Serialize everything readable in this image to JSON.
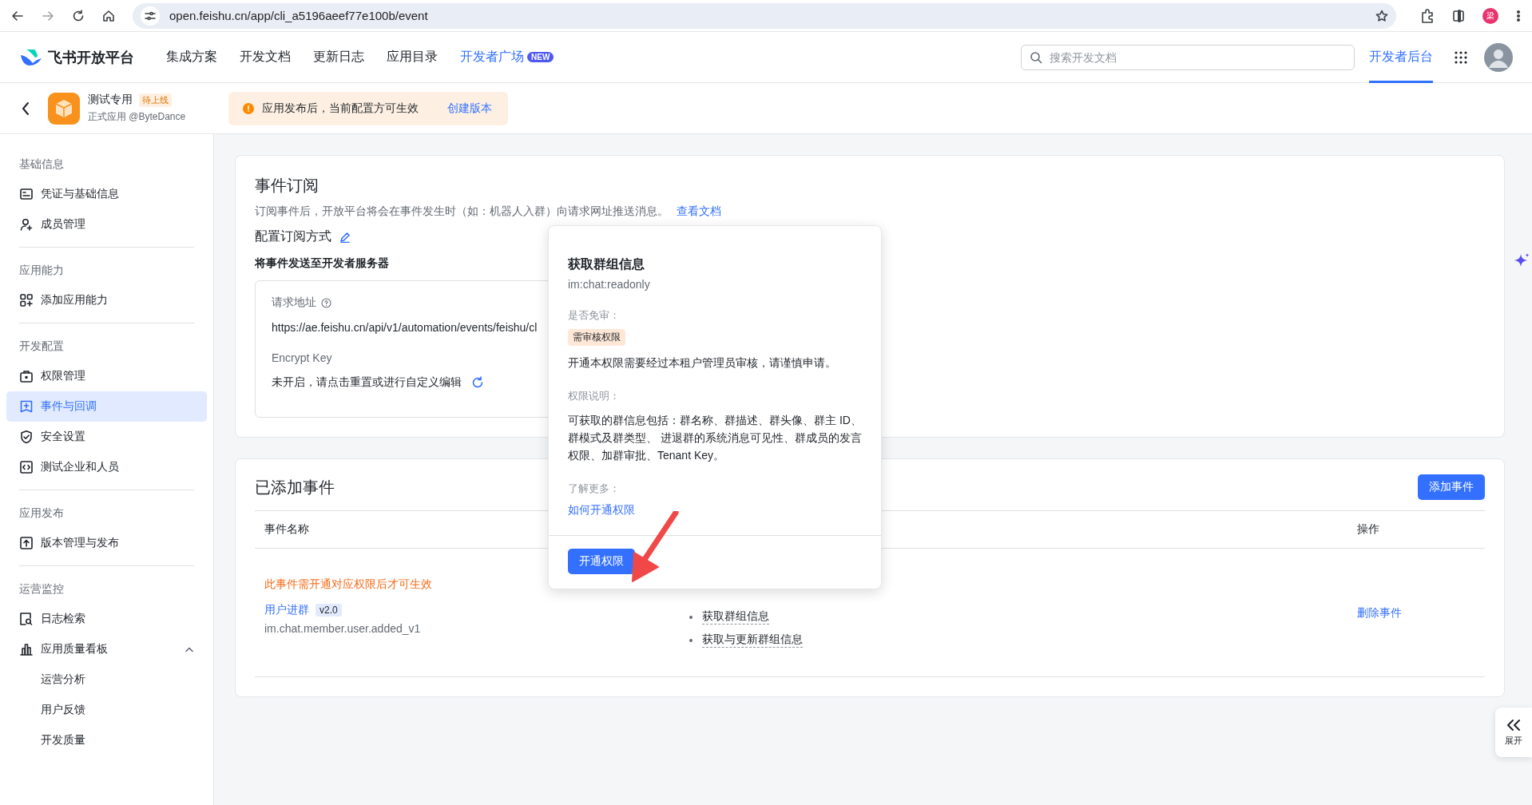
{
  "browser": {
    "url": "open.feishu.cn/app/cli_a5196aeef77e100b/event",
    "profile_initial": "梁"
  },
  "top_nav": {
    "logo_text": "飞书开放平台",
    "items": [
      {
        "label": "集成方案",
        "highlight": false
      },
      {
        "label": "开发文档",
        "highlight": false
      },
      {
        "label": "更新日志",
        "highlight": false
      },
      {
        "label": "应用目录",
        "highlight": false
      },
      {
        "label": "开发者广场",
        "highlight": true,
        "badge": "NEW"
      }
    ],
    "search": {
      "placeholder": "搜索开发文档"
    },
    "console_tab": {
      "label": "开发者后台",
      "selected": true
    }
  },
  "app_header": {
    "name": "测试专用",
    "status": "待上线",
    "subtitle": "正式应用 @ByteDance",
    "notice": "应用发布后，当前配置方可生效",
    "notice_link": "创建版本"
  },
  "sidebar": {
    "groups": [
      {
        "title": "基础信息",
        "items": [
          {
            "label": "凭证与基础信息",
            "selected": false
          },
          {
            "label": "成员管理",
            "selected": false
          }
        ]
      },
      {
        "title": "应用能力",
        "items": [
          {
            "label": "添加应用能力",
            "selected": false
          }
        ]
      },
      {
        "title": "开发配置",
        "items": [
          {
            "label": "权限管理",
            "selected": false
          },
          {
            "label": "事件与回调",
            "selected": true
          },
          {
            "label": "安全设置",
            "selected": false
          },
          {
            "label": "测试企业和人员",
            "selected": false
          }
        ]
      },
      {
        "title": "应用发布",
        "items": [
          {
            "label": "版本管理与发布",
            "selected": false
          }
        ]
      },
      {
        "title": "运营监控",
        "items": [
          {
            "label": "日志检索",
            "selected": false
          },
          {
            "label": "应用质量看板",
            "selected": false,
            "expanded": true,
            "children": [
              {
                "label": "运营分析",
                "selected": false
              },
              {
                "label": "用户反馈",
                "selected": false
              },
              {
                "label": "开发质量",
                "selected": false
              }
            ]
          }
        ]
      }
    ]
  },
  "subscription": {
    "title": "事件订阅",
    "description": "订阅事件后，开放平台将会在事件发生时（如：机器人入群）向请求网址推送消息。",
    "doc_link": "查看文档",
    "config_title": "配置订阅方式",
    "mode": "将事件发送至开发者服务器",
    "fields": [
      {
        "label": "请求地址",
        "value": "https://ae.feishu.cn/api/v1/automation/events/feishu/cl"
      },
      {
        "label": "Encrypt Key",
        "value": "未开启，请点击重置或进行自定义编辑"
      }
    ]
  },
  "events": {
    "title": "已添加事件",
    "add_button": "添加事件",
    "columns": [
      {
        "label": "事件名称"
      },
      {
        "label": "操作"
      }
    ],
    "rows": [
      {
        "warning": "此事件需开通对应权限后才可生效",
        "name": "用户进群",
        "version": "v2.0",
        "key": "im.chat.member.user.added_v1",
        "permissions": [
          "获取群组信息",
          "获取与更新群组信息"
        ],
        "action": "删除事件"
      }
    ]
  },
  "popover": {
    "title": "获取群组信息",
    "scope": "im:chat:readonly",
    "review_label": "是否免审：",
    "review_tag": "需审核权限",
    "review_note": "开通本权限需要经过本租户管理员审核，请谨慎申请。",
    "desc_label": "权限说明：",
    "desc": "可获取的群信息包括：群名称、群描述、群头像、群主 ID、群模式及群类型、 进退群的系统消息可见性、群成员的发言权限、加群审批、Tenant Key。",
    "more_label": "了解更多：",
    "more_link": "如何开通权限",
    "button": "开通权限"
  },
  "side_toggle": {
    "label": "展开"
  }
}
